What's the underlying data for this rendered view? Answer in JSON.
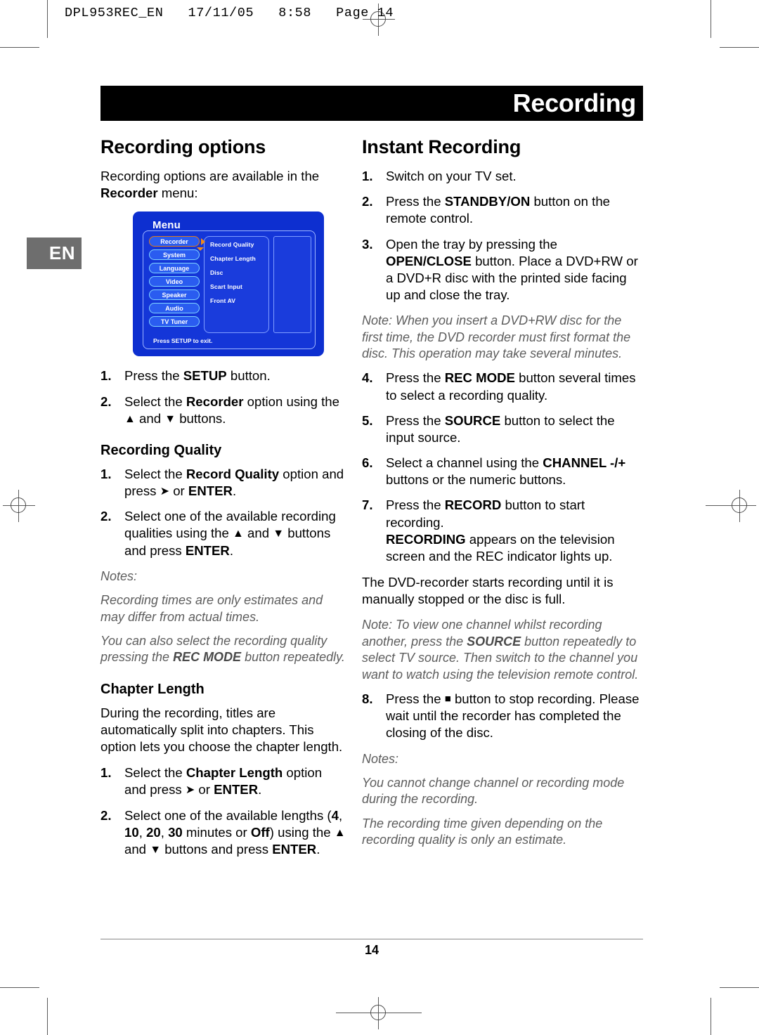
{
  "file_header": "DPL953REC_EN   17/11/05   8:58   Page 14",
  "language_tab": "EN",
  "chapter_banner": "Recording",
  "page_number": "14",
  "left_column": {
    "section_title": "Recording options",
    "intro": {
      "part1": "Recording options are available in the ",
      "bold": "Recorder",
      "part2": " menu:"
    },
    "osd": {
      "title": "Menu",
      "left_buttons": [
        "Recorder",
        "System",
        "Language",
        "Video",
        "Speaker",
        "Audio",
        "TV Tuner"
      ],
      "selected_button": "Recorder",
      "mid_items": [
        "Record Quality",
        "Chapter Length",
        "Disc",
        "Scart Input",
        "Front AV"
      ],
      "footer": "Press SETUP to exit."
    },
    "steps_top": [
      {
        "num": "1.",
        "segments": [
          {
            "t": "Press the ",
            "s": "n"
          },
          {
            "t": "SETUP",
            "s": "b"
          },
          {
            "t": " button.",
            "s": "n"
          }
        ]
      },
      {
        "num": "2.",
        "segments": [
          {
            "t": "Select the ",
            "s": "n"
          },
          {
            "t": "Recorder",
            "s": "b"
          },
          {
            "t": " option using the ",
            "s": "n"
          },
          {
            "t": "▲",
            "s": "a"
          },
          {
            "t": " and ",
            "s": "n"
          },
          {
            "t": "▼",
            "s": "a"
          },
          {
            "t": " buttons.",
            "s": "n"
          }
        ]
      }
    ],
    "sub_quality": {
      "heading": "Recording Quality",
      "steps": [
        {
          "num": "1.",
          "segments": [
            {
              "t": "Select the ",
              "s": "n"
            },
            {
              "t": "Record Quality",
              "s": "b"
            },
            {
              "t": " option and press ",
              "s": "n"
            },
            {
              "t": "➤",
              "s": "a"
            },
            {
              "t": " or ",
              "s": "n"
            },
            {
              "t": "ENTER",
              "s": "b"
            },
            {
              "t": ".",
              "s": "n"
            }
          ]
        },
        {
          "num": "2.",
          "segments": [
            {
              "t": "Select one of the available recording qualities using the ",
              "s": "n"
            },
            {
              "t": "▲",
              "s": "a"
            },
            {
              "t": " and ",
              "s": "n"
            },
            {
              "t": "▼",
              "s": "a"
            },
            {
              "t": " buttons and press ",
              "s": "n"
            },
            {
              "t": "ENTER",
              "s": "b"
            },
            {
              "t": ".",
              "s": "n"
            }
          ]
        }
      ],
      "notes_label": "Notes:",
      "note1": "Recording times are only estimates and may differ from actual times.",
      "note2": {
        "part1": "You can also select the recording quality pressing the ",
        "bold": "REC MODE",
        "part2": " button repeatedly."
      }
    },
    "sub_chapter": {
      "heading": "Chapter Length",
      "paragraph": "During the recording, titles are automatically split into chapters. This option lets you choose the chapter length.",
      "steps": [
        {
          "num": "1.",
          "segments": [
            {
              "t": "Select the ",
              "s": "n"
            },
            {
              "t": "Chapter Length",
              "s": "b"
            },
            {
              "t": " option and press ",
              "s": "n"
            },
            {
              "t": "➤",
              "s": "a"
            },
            {
              "t": " or ",
              "s": "n"
            },
            {
              "t": "ENTER",
              "s": "b"
            },
            {
              "t": ".",
              "s": "n"
            }
          ]
        },
        {
          "num": "2.",
          "segments": [
            {
              "t": "Select one of the available lengths (",
              "s": "n"
            },
            {
              "t": "4",
              "s": "b"
            },
            {
              "t": ", ",
              "s": "n"
            },
            {
              "t": "10",
              "s": "b"
            },
            {
              "t": ", ",
              "s": "n"
            },
            {
              "t": "20",
              "s": "b"
            },
            {
              "t": ", ",
              "s": "n"
            },
            {
              "t": "30",
              "s": "b"
            },
            {
              "t": " minutes or ",
              "s": "n"
            },
            {
              "t": "Off",
              "s": "b"
            },
            {
              "t": ") using the ",
              "s": "n"
            },
            {
              "t": "▲",
              "s": "a"
            },
            {
              "t": " and ",
              "s": "n"
            },
            {
              "t": "▼",
              "s": "a"
            },
            {
              "t": " buttons and press ",
              "s": "n"
            },
            {
              "t": "ENTER",
              "s": "b"
            },
            {
              "t": ".",
              "s": "n"
            }
          ]
        }
      ]
    }
  },
  "right_column": {
    "section_title": "Instant Recording",
    "steps": [
      {
        "num": "1.",
        "segments": [
          {
            "t": "Switch on your TV set.",
            "s": "n"
          }
        ]
      },
      {
        "num": "2.",
        "segments": [
          {
            "t": "Press the ",
            "s": "n"
          },
          {
            "t": "STANDBY/ON",
            "s": "b"
          },
          {
            "t": " button on the remote control.",
            "s": "n"
          }
        ]
      },
      {
        "num": "3.",
        "segments": [
          {
            "t": "Open the tray by pressing the ",
            "s": "n"
          },
          {
            "t": "OPEN/CLOSE",
            "s": "b"
          },
          {
            "t": " button. Place a DVD+RW or a DVD+R disc with the printed side facing up and close the tray.",
            "s": "n"
          }
        ]
      }
    ],
    "note_format": "Note: When you insert a DVD+RW disc for the first time, the DVD recorder must first format the disc. This operation may take several minutes.",
    "steps2": [
      {
        "num": "4.",
        "segments": [
          {
            "t": "Press the ",
            "s": "n"
          },
          {
            "t": "REC MODE",
            "s": "b"
          },
          {
            "t": " button several times to select a recording quality.",
            "s": "n"
          }
        ]
      },
      {
        "num": "5.",
        "segments": [
          {
            "t": "Press the ",
            "s": "n"
          },
          {
            "t": "SOURCE",
            "s": "b"
          },
          {
            "t": " button to select the input source.",
            "s": "n"
          }
        ]
      },
      {
        "num": "6.",
        "segments": [
          {
            "t": "Select a channel using the ",
            "s": "n"
          },
          {
            "t": "CHANNEL -/+",
            "s": "b"
          },
          {
            "t": " buttons or the numeric buttons.",
            "s": "n"
          }
        ]
      },
      {
        "num": "7.",
        "segments": [
          {
            "t": "Press the ",
            "s": "n"
          },
          {
            "t": "RECORD",
            "s": "b"
          },
          {
            "t": " button to start recording.",
            "s": "n"
          },
          {
            "t": "BR",
            "s": "br"
          },
          {
            "t": "RECORDING",
            "s": "b"
          },
          {
            "t": " appears on the television screen and the REC indicator lights up.",
            "s": "n"
          }
        ]
      }
    ],
    "paragraph": "The DVD-recorder starts recording until it is manually stopped or the disc is full.",
    "note_view": {
      "part1": "Note: To view one channel whilst recording another, press the ",
      "bold": "SOURCE",
      "part2": " button repeatedly to select TV source. Then switch to the channel you want to watch using the television remote control."
    },
    "step8": {
      "num": "8.",
      "segments": [
        {
          "t": "Press the ",
          "s": "n"
        },
        {
          "t": "■",
          "s": "sq"
        },
        {
          "t": " button to stop recording. Please wait until the recorder has completed the closing of the disc.",
          "s": "n"
        }
      ]
    },
    "notes_label": "Notes:",
    "note1": "You cannot change channel or recording mode during the recording.",
    "note2": "The recording time given depending on the recording quality is only an estimate."
  }
}
